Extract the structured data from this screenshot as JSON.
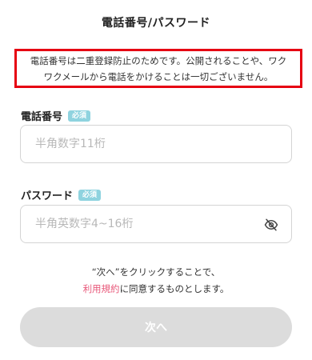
{
  "header": {
    "title": "電話番号/パスワード"
  },
  "notice": {
    "line1": "電話番号は二重登録防止のためです。公開されることや、ワク",
    "line2": "ワクメールから電話をかけることは一切ございません。",
    "border_color": "#e60012"
  },
  "phone": {
    "label": "電話番号",
    "badge": "必須",
    "placeholder": "半角数字11桁",
    "value": ""
  },
  "password": {
    "label": "パスワード",
    "badge": "必須",
    "placeholder": "半角英数字4~16桁",
    "value": "",
    "toggle_icon": "eye-slash-icon"
  },
  "agreement": {
    "line1": "“次へ”をクリックすることで、",
    "terms_link": "利用規約",
    "line2_suffix": "に同意するものとします。"
  },
  "next_button": {
    "label": "次へ",
    "disabled": true,
    "color": "#dcdcdc"
  },
  "colors": {
    "badge": "#8fd3df",
    "link": "#e8587a"
  }
}
